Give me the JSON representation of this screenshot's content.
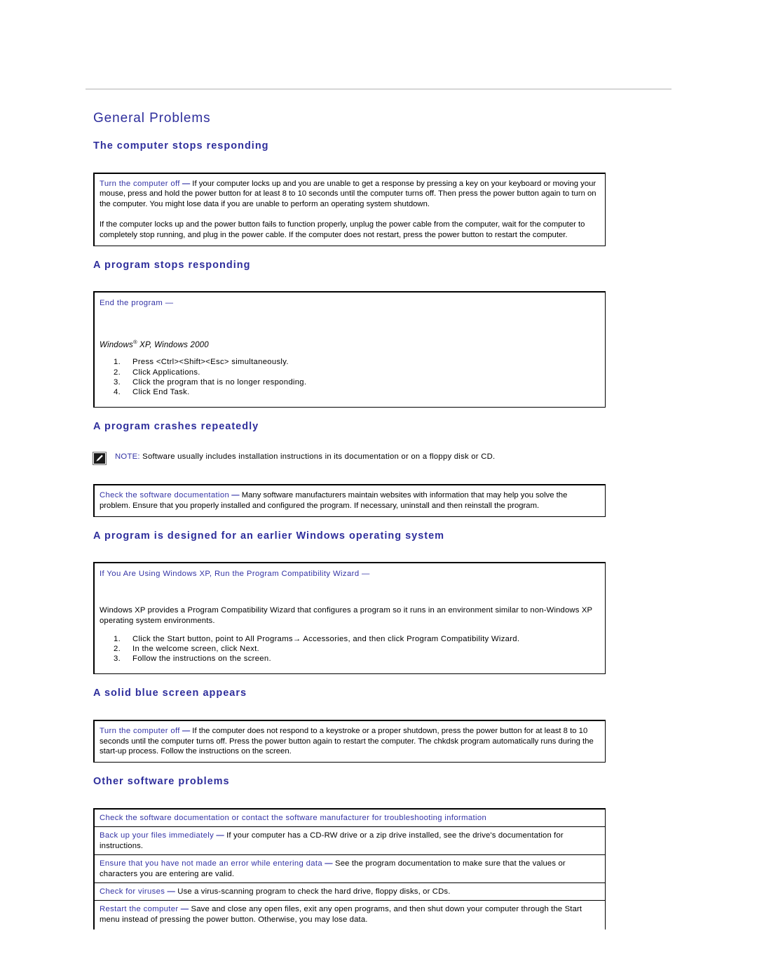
{
  "page": {
    "section_title": "General Problems",
    "accent_color": "#2e2e9c",
    "lead_color": "#3333a5"
  },
  "sections": {
    "computer_stops": {
      "heading": "The computer stops responding",
      "box": {
        "lead": "Turn the computer off",
        "dash": "—",
        "p1": " If your computer locks up and you are unable to get a response by pressing a key on your keyboard or moving your mouse, press and hold the power button for at least 8 to 10 seconds until the computer turns off. Then press the power button again to turn on the computer. You might lose data if you are unable to perform an operating system shutdown.",
        "p2": "If the computer locks up and the power button fails to function properly, unplug the power cable from the computer, wait for the computer to completely stop running, and plug in the power cable. If the computer does not restart, press the power button to restart the computer."
      }
    },
    "program_stops": {
      "heading": "A program stops responding",
      "panel": {
        "head_lead": "End the program",
        "head_dash": "—",
        "os_line": "Windows",
        "os_sup": "®",
        "os_line_rest": " XP, Windows 2000",
        "steps": [
          "Press <Ctrl><Shift><Esc> simultaneously.",
          "Click Applications.",
          "Click the program that is no longer responding.",
          "Click End Task."
        ]
      }
    },
    "program_crashes": {
      "heading": "A program crashes repeatedly",
      "note": {
        "icon": "note-pencil-icon",
        "label": "NOTE:",
        "text": " Software usually includes installation instructions in its documentation or on a floppy disk or CD."
      },
      "box": {
        "lead": "Check the software documentation",
        "dash": "—",
        "p1": " Many software manufacturers maintain websites with information that may help you solve the problem. Ensure that you properly installed and configured the program. If necessary, uninstall and then reinstall the program."
      }
    },
    "earlier_windows": {
      "heading": "A program is designed for an earlier Windows operating system",
      "panel": {
        "head_lead": "If You Are Using Windows XP, Run the Program Compatibility Wizard",
        "head_dash": "—",
        "body": "Windows XP provides a Program Compatibility Wizard that configures a program so it runs in an environment similar to non-Windows XP operating system environments.",
        "steps": [
          "Click the Start button, point to All Programs→ Accessories, and then click Program Compatibility Wizard.",
          "In the welcome screen, click Next.",
          "Follow the instructions on the screen."
        ]
      }
    },
    "blue_screen": {
      "heading": "A solid blue screen appears",
      "box": {
        "lead": "Turn the computer off",
        "dash": "—",
        "p1": " If the computer does not respond to a keystroke or a proper shutdown, press the power button for at least 8 to 10 seconds until the computer turns off. Press the power button again to restart the computer. The chkdsk program automatically runs during the start-up process. Follow the instructions on the screen."
      }
    },
    "other_software": {
      "heading": "Other software problems",
      "rows": [
        {
          "lead": "Check the software documentation or contact the software manufacturer for troubleshooting information",
          "dash": "",
          "text": ""
        },
        {
          "lead": "Back up your files immediately",
          "dash": "—",
          "text": " If your computer has a CD-RW drive or a zip drive installed, see the drive's documentation for instructions."
        },
        {
          "lead": "Ensure that you have not made an error while entering data",
          "dash": "—",
          "text": " See the program documentation to make sure that the values or characters you are entering are valid."
        },
        {
          "lead": "Check for viruses",
          "dash": "—",
          "text": " Use a virus-scanning program to check the hard drive, floppy disks, or CDs."
        },
        {
          "lead": "Restart the computer",
          "dash": "—",
          "text": " Save and close any open files, exit any open programs, and then shut down your computer through the Start menu instead of pressing the power button. Otherwise, you may lose data."
        }
      ]
    }
  }
}
